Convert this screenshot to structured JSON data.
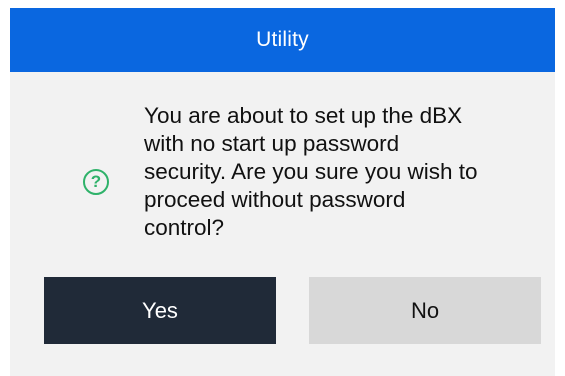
{
  "dialog": {
    "title": "Utility",
    "icon": "question-circle-icon",
    "icon_glyph": "?",
    "message": "You are about to set up the dBX\nwith no start up password\nsecurity. Are you sure you wish to\nproceed without password\ncontrol?",
    "yes_label": "Yes",
    "no_label": "No"
  },
  "colors": {
    "title_bar": "#0a67e0",
    "dialog_background": "#f2f2f2",
    "icon": "#2fb26a",
    "yes_button": "#202a38",
    "no_button": "#d8d8d8"
  }
}
